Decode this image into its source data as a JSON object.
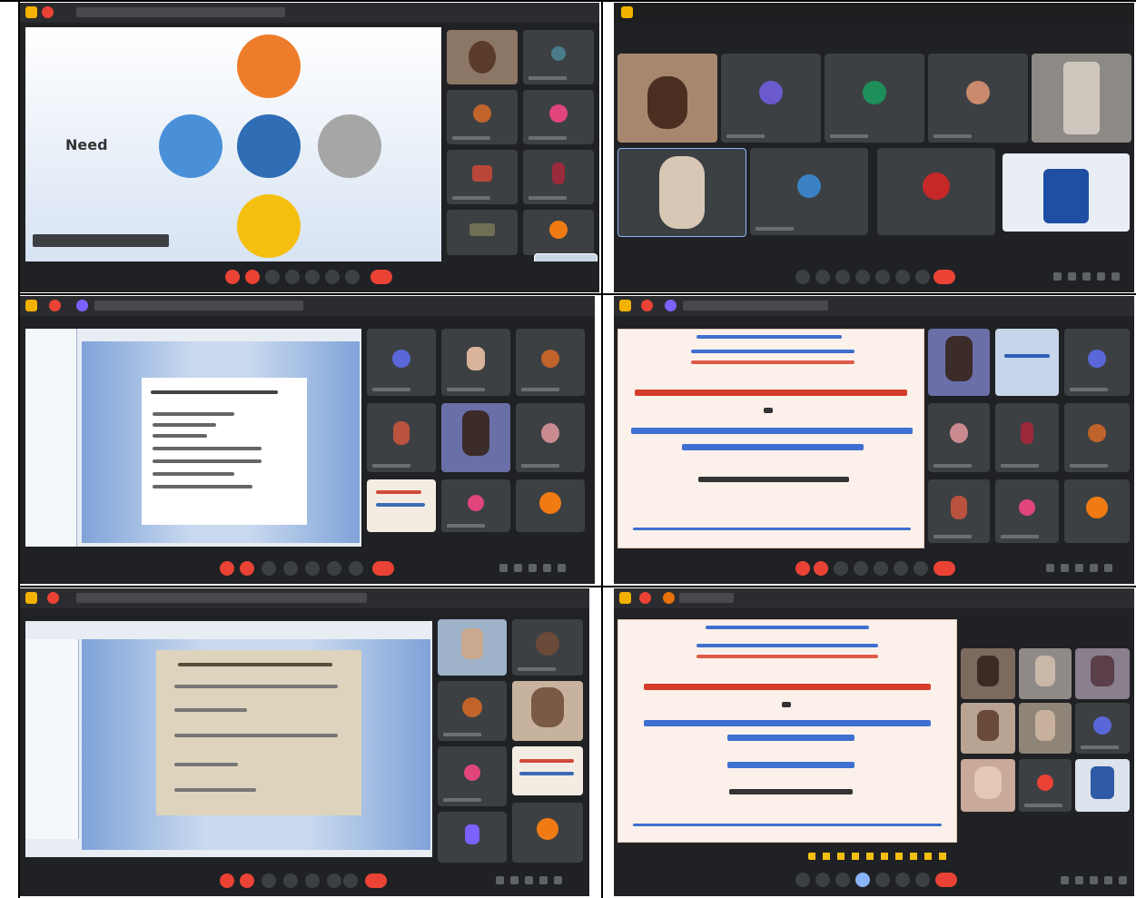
{
  "panels": [
    {
      "id": "p1",
      "title": "",
      "meeting_info": "",
      "slide_label": "Need"
    },
    {
      "id": "p2",
      "title": "",
      "meeting_info": ""
    },
    {
      "id": "p3",
      "title": "",
      "meeting_info": ""
    },
    {
      "id": "p4",
      "title": "",
      "meeting_info": ""
    },
    {
      "id": "p5",
      "title": "",
      "meeting_info": ""
    },
    {
      "id": "p6",
      "title": "",
      "meeting_info": ""
    }
  ],
  "colors": {
    "meet_bg": "#202124",
    "tile": "#3c4043",
    "end_call": "#ea4335",
    "accent_orange": "#ee7d2b",
    "accent_blue": "#3f8fd7",
    "accent_yellow": "#f5bf10",
    "accent_grey": "#a6a6a6"
  }
}
